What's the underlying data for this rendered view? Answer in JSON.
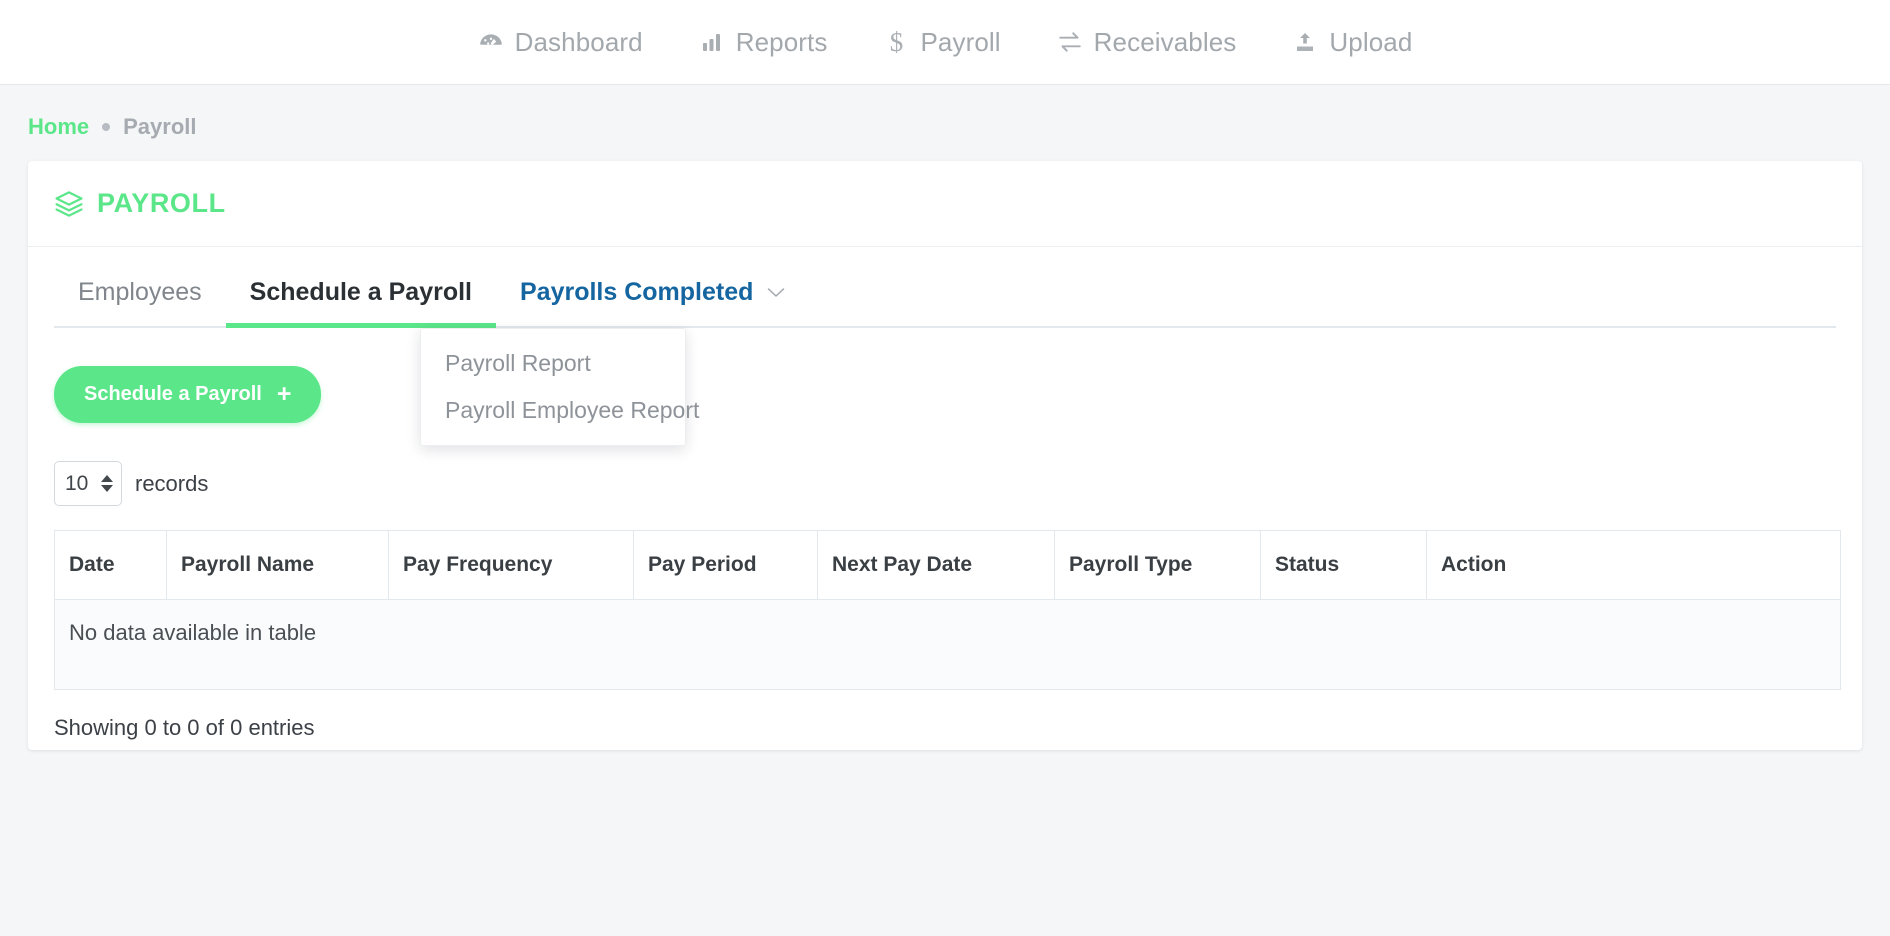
{
  "topnav": {
    "items": [
      {
        "label": "Dashboard",
        "icon": "dashboard-icon"
      },
      {
        "label": "Reports",
        "icon": "bar-chart-icon"
      },
      {
        "label": "Payroll",
        "icon": "dollar-icon"
      },
      {
        "label": "Receivables",
        "icon": "exchange-arrows-icon"
      },
      {
        "label": "Upload",
        "icon": "upload-icon"
      }
    ]
  },
  "breadcrumb": {
    "home": "Home",
    "separator": "•",
    "current": "Payroll"
  },
  "card": {
    "title": "PAYROLL",
    "title_icon": "layers-icon",
    "tabs": [
      {
        "label": "Employees",
        "state": "inactive"
      },
      {
        "label": "Schedule a Payroll",
        "state": "active"
      },
      {
        "label": "Payrolls Completed",
        "state": "dropdown"
      }
    ],
    "dropdown": {
      "open": true,
      "items": [
        {
          "label": "Payroll Report"
        },
        {
          "label": "Payroll Employee Report"
        }
      ]
    },
    "schedule_button": {
      "label": "Schedule a Payroll",
      "plus": "+"
    },
    "records": {
      "value": "10",
      "label": "records"
    },
    "table": {
      "headers": [
        "Date",
        "Payroll Name",
        "Pay Frequency",
        "Pay Period",
        "Next Pay Date",
        "Payroll Type",
        "Status",
        "Action"
      ],
      "empty_message": "No data available in table",
      "footer": "Showing 0 to 0 of 0 entries"
    }
  },
  "colors": {
    "brand_green": "#5ce68a",
    "link_blue": "#1565a0",
    "page_bg": "#f5f6f7",
    "muted_text": "#a3a8ad"
  }
}
